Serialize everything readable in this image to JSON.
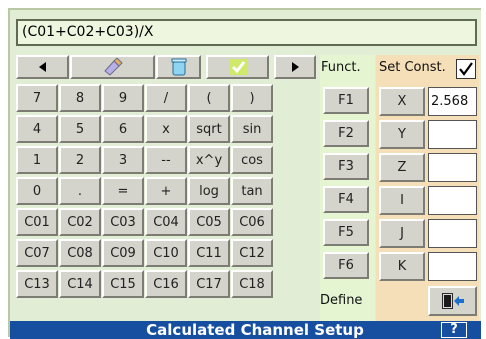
{
  "formula": "(C01+C02+C03)/X",
  "keypad": {
    "nav": {
      "left_icon": "left-triangle",
      "eraser_icon": "eraser",
      "trash_icon": "recycle-bin",
      "check_icon": "check-mark",
      "right_icon": "right-triangle"
    },
    "rows": [
      [
        "7",
        "8",
        "9",
        "/",
        "(",
        ")"
      ],
      [
        "4",
        "5",
        "6",
        "x",
        "sqrt",
        "sin"
      ],
      [
        "1",
        "2",
        "3",
        "--",
        "x^y",
        "cos"
      ],
      [
        "0",
        ".",
        "=",
        "+",
        "log",
        "tan"
      ],
      [
        "C01",
        "C02",
        "C03",
        "C04",
        "C05",
        "C06"
      ],
      [
        "C07",
        "C08",
        "C09",
        "C10",
        "C11",
        "C12"
      ],
      [
        "C13",
        "C14",
        "C15",
        "C16",
        "C17",
        "C18"
      ]
    ]
  },
  "funct": {
    "header": "Funct.",
    "keys": [
      "F1",
      "F2",
      "F3",
      "F4",
      "F5",
      "F6"
    ],
    "define_label": "Define",
    "define_checked": false
  },
  "constants": {
    "header": "Set Const.",
    "enabled": true,
    "items": [
      {
        "name": "X",
        "value": "2.568"
      },
      {
        "name": "Y",
        "value": ""
      },
      {
        "name": "Z",
        "value": ""
      },
      {
        "name": "I",
        "value": ""
      },
      {
        "name": "J",
        "value": ""
      },
      {
        "name": "K",
        "value": ""
      }
    ],
    "exit_icon": "exit-door"
  },
  "status_bar": {
    "title": "Calculated Channel Setup",
    "help": "?"
  },
  "colors": {
    "background": "#e1edd4",
    "status_bar": "#164ea0",
    "const_panel": "#f5dfb8",
    "func_panel": "#e5f5d2"
  }
}
